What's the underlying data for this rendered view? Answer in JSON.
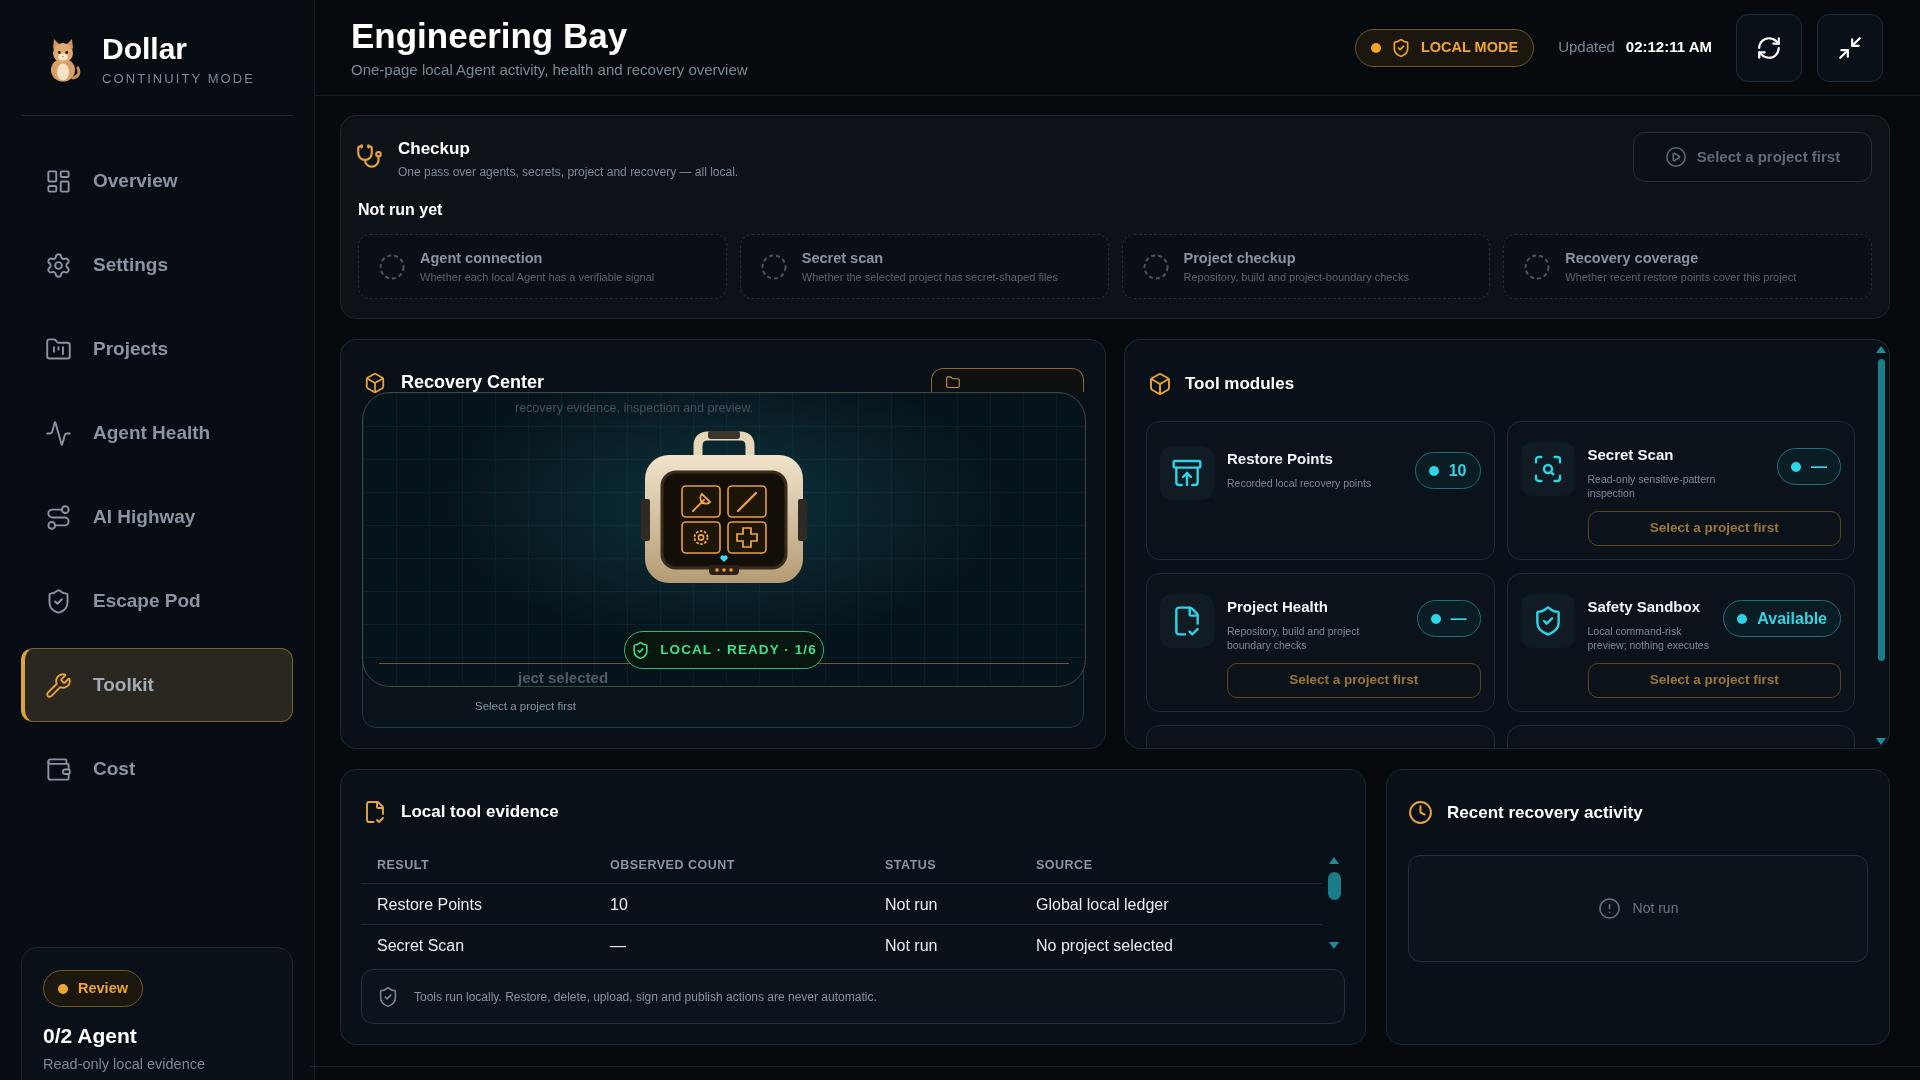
{
  "sidebar": {
    "brand": {
      "name": "Dollar",
      "subtitle": "CONTINUITY MODE"
    },
    "items": [
      {
        "label": "Overview",
        "selected": false
      },
      {
        "label": "Settings",
        "selected": false
      },
      {
        "label": "Projects",
        "selected": false
      },
      {
        "label": "Agent Health",
        "selected": false
      },
      {
        "label": "AI Highway",
        "selected": false
      },
      {
        "label": "Escape Pod",
        "selected": false
      },
      {
        "label": "Toolkit",
        "selected": true
      },
      {
        "label": "Cost",
        "selected": false
      }
    ],
    "status_card": {
      "badge": "Review",
      "title": "0/2 Agent",
      "subtitle": "Read-only local evidence"
    }
  },
  "header": {
    "title": "Engineering Bay",
    "subtitle": "One-page local Agent activity, health and recovery overview",
    "mode_badge": "LOCAL MODE",
    "updated_label": "Updated",
    "updated_time": "02:12:11 AM"
  },
  "checkup": {
    "title": "Checkup",
    "subtitle": "One pass over agents, secrets, project and recovery — all local.",
    "action": {
      "label": "Select a project first",
      "disabled": true
    },
    "status": "Not run yet",
    "steps": [
      {
        "title": "Agent connection",
        "description": "Whether each local Agent has a verifiable signal"
      },
      {
        "title": "Secret scan",
        "description": "Whether the selected project has secret-shaped files"
      },
      {
        "title": "Project checkup",
        "description": "Repository, build and project-boundary checks"
      },
      {
        "title": "Recovery coverage",
        "description": "Whether recent restore points cover this project"
      }
    ]
  },
  "recovery_center": {
    "title": "Recovery Center",
    "subtitle": "recovery evidence, inspection and preview.",
    "status_badge": "LOCAL · READY · 1/6",
    "body_title": "ject selected",
    "hint": "Select a project first"
  },
  "tool_modules": {
    "title": "Tool modules",
    "modules": [
      {
        "title": "Restore Points",
        "description": "Recorded local recovery points",
        "value": "10"
      },
      {
        "title": "Secret Scan",
        "description": "Read-only sensitive-pattern inspection",
        "value": "—",
        "action": "Select a project first"
      },
      {
        "title": "Project Health",
        "description": "Repository, build and project boundary checks",
        "value": "—",
        "action": "Select a project first"
      },
      {
        "title": "Safety Sandbox",
        "description": "Local command-risk preview; nothing executes",
        "value": "Available",
        "action": "Select a project first"
      }
    ]
  },
  "evidence": {
    "title": "Local tool evidence",
    "table": {
      "columns": [
        "RESULT",
        "OBSERVED COUNT",
        "STATUS",
        "SOURCE"
      ],
      "rows": [
        [
          "Restore Points",
          "10",
          "Not run",
          "Global local ledger"
        ],
        [
          "Secret Scan",
          "—",
          "Not run",
          "No project selected"
        ]
      ]
    },
    "note": "Tools run locally. Restore, delete, upload, sign and publish actions are never automatic."
  },
  "recent_activity": {
    "title": "Recent recovery activity",
    "empty_text": "Not run"
  }
}
